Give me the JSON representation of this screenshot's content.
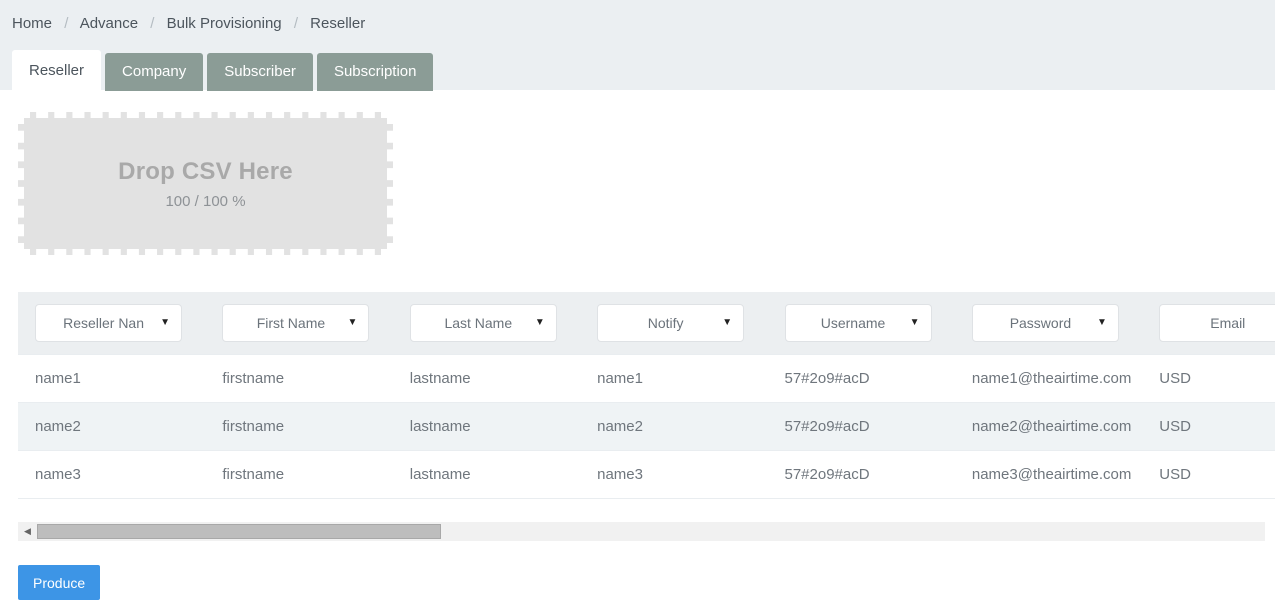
{
  "breadcrumb": {
    "separator": "/",
    "items": [
      {
        "label": "Home"
      },
      {
        "label": "Advance"
      },
      {
        "label": "Bulk Provisioning"
      },
      {
        "label": "Reseller"
      }
    ]
  },
  "tabs": [
    {
      "label": "Reseller",
      "active": true
    },
    {
      "label": "Company",
      "active": false
    },
    {
      "label": "Subscriber",
      "active": false
    },
    {
      "label": "Subscription",
      "active": false
    }
  ],
  "dropzone": {
    "title": "Drop CSV Here",
    "progress": "100 / 100 %"
  },
  "table": {
    "columns": [
      {
        "selected": "Reseller Nan",
        "key": "reseller_name"
      },
      {
        "selected": "First Name",
        "key": "first_name"
      },
      {
        "selected": "Last Name",
        "key": "last_name"
      },
      {
        "selected": "Notify",
        "key": "notify"
      },
      {
        "selected": "Username",
        "key": "username"
      },
      {
        "selected": "Password",
        "key": "password"
      },
      {
        "selected": "Email",
        "key": "email"
      },
      {
        "selected": "",
        "key": "currency"
      }
    ],
    "rows": [
      {
        "reseller_name": "name1",
        "first_name": "firstname",
        "last_name": "lastname",
        "notify": "name1",
        "username": "57#2o9#acD",
        "password": "name1@theairtime.com",
        "email": "USD",
        "currency": ""
      },
      {
        "reseller_name": "name2",
        "first_name": "firstname",
        "last_name": "lastname",
        "notify": "name2",
        "username": "57#2o9#acD",
        "password": "name2@theairtime.com",
        "email": "USD",
        "currency": ""
      },
      {
        "reseller_name": "name3",
        "first_name": "firstname",
        "last_name": "lastname",
        "notify": "name3",
        "username": "57#2o9#acD",
        "password": "name3@theairtime.com",
        "email": "USD",
        "currency": ""
      }
    ]
  },
  "scrollbar": {
    "left_arrow": "◀"
  },
  "actions": {
    "produce_label": "Produce"
  },
  "caret_glyph": "▼",
  "colors": {
    "header_band": "#ebeff2",
    "tab_inactive": "#8b9c96",
    "tab_active": "#ffffff",
    "dropzone_fill": "#e2e2e2",
    "row_alt": "#eff3f5",
    "primary_button": "#3d95e6"
  }
}
